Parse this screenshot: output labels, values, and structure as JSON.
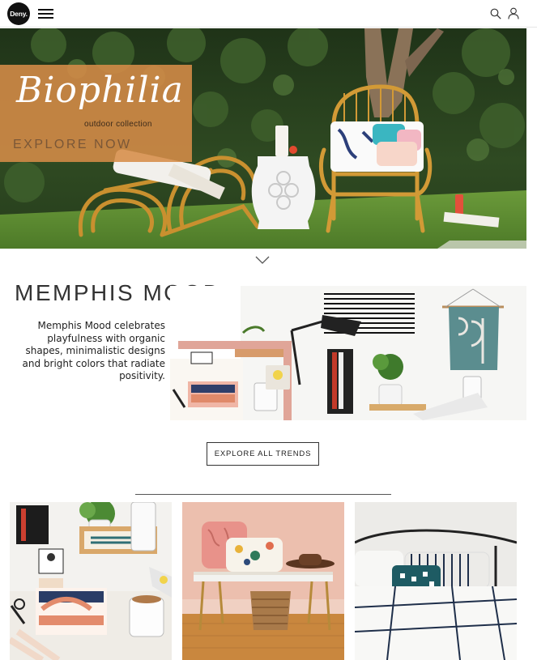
{
  "header": {
    "logo_text": "Deny.",
    "menu_icon": "hamburger-menu-icon",
    "search_icon": "search-icon",
    "account_icon": "user-icon"
  },
  "hero": {
    "title": "Biophilia",
    "subtitle": "outdoor collection",
    "cta": "EXPLORE NOW",
    "overlay_color": "#d68c48"
  },
  "scroll_icon": "chevron-down-icon",
  "memphis": {
    "title": "MEMPHIS MOOD",
    "description": "Memphis Mood celebrates playfulness with organic shapes, minimalistic designs and bright colors that radiate positivity."
  },
  "trends_button": "EXPLORE ALL TRENDS",
  "colors": {
    "accent": "#d68c48",
    "text": "#222222",
    "button_border": "#333333"
  }
}
